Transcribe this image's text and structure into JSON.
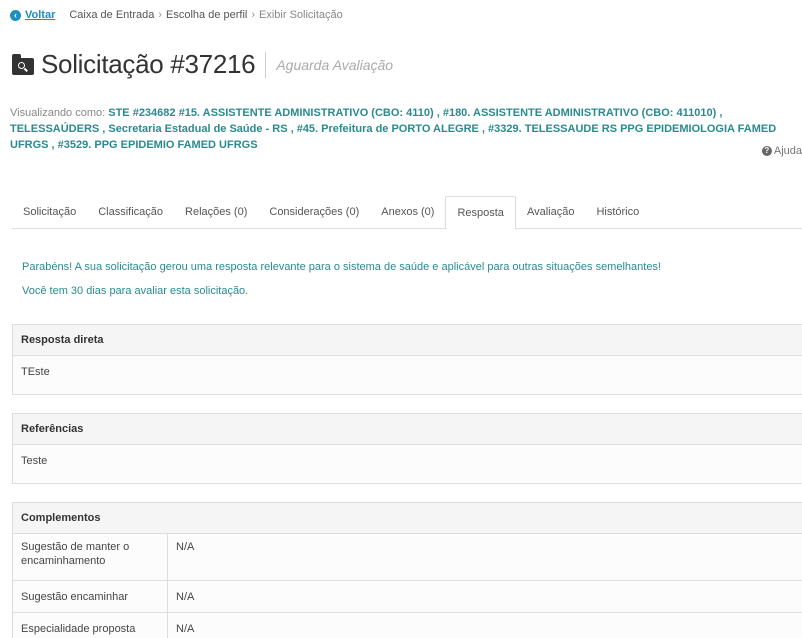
{
  "breadcrumb": {
    "back_label": "Voltar",
    "items": [
      "Caixa de Entrada",
      "Escolha de perfil",
      "Exibir Solicitação"
    ]
  },
  "header": {
    "title": "Solicitação #37216",
    "status": "Aguarda Avaliação"
  },
  "viewing": {
    "label": "Visualizando como:",
    "text": "STE #234682 #15. ASSISTENTE ADMINISTRATIVO (CBO: 4110) , #180. ASSISTENTE ADMINISTRATIVO (CBO: 411010) , TELESSAÚDERS , Secretaria Estadual de Saúde - RS , #45. Prefeitura de PORTO ALEGRE , #3329. TELESSAUDE RS PPG EPIDEMIOLOGIA FAMED UFRGS , #3529. PPG EPIDEMIO FAMED UFRGS"
  },
  "help_label": "Ajuda",
  "tabs": [
    {
      "label": "Solicitação"
    },
    {
      "label": "Classificação"
    },
    {
      "label": "Relações (0)"
    },
    {
      "label": "Considerações (0)"
    },
    {
      "label": "Anexos (0)"
    },
    {
      "label": "Resposta"
    },
    {
      "label": "Avaliação"
    },
    {
      "label": "Histórico"
    }
  ],
  "active_tab": "Resposta",
  "messages": {
    "congrats": "Parabéns! A sua solicitação gerou uma resposta relevante para o sistema de saúde e aplicável para outras situações semelhantes!",
    "days": "Você tem 30 dias para avaliar esta solicitação."
  },
  "resposta_direta": {
    "title": "Resposta direta",
    "value": "TEste"
  },
  "referencias": {
    "title": "Referências",
    "value": "Teste"
  },
  "complementos": {
    "title": "Complementos",
    "rows": [
      {
        "label": "Sugestão de manter o encaminhamento",
        "value": "N/A"
      },
      {
        "label": "Sugestão encaminhar",
        "value": "N/A"
      },
      {
        "label": "Especialidade proposta",
        "value": "N/A"
      }
    ]
  },
  "colors": {
    "link": "#1d8fbf",
    "accent_teal": "#2a8a8f"
  }
}
